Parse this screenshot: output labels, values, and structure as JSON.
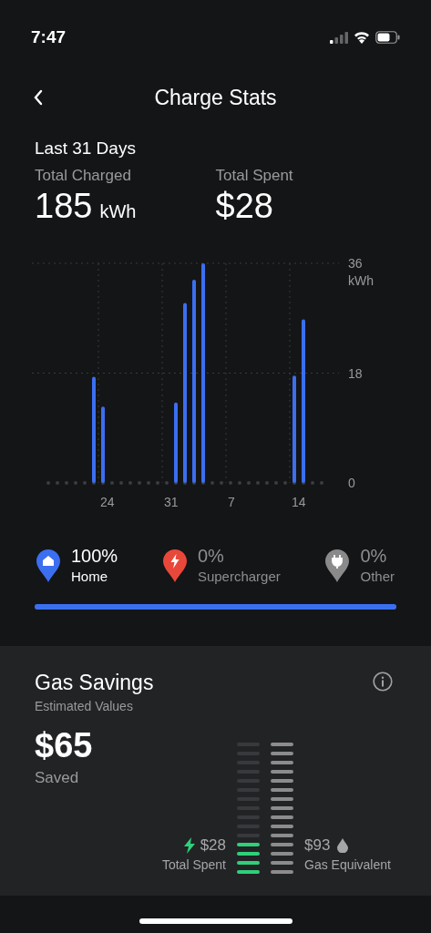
{
  "status_bar": {
    "time": "7:47"
  },
  "header": {
    "title": "Charge Stats"
  },
  "period": "Last 31 Days",
  "stats": [
    {
      "label": "Total Charged",
      "value": "185",
      "unit": "kWh"
    },
    {
      "label": "Total Spent",
      "value": "$28"
    }
  ],
  "chart_data": {
    "type": "bar",
    "ylabel": "kWh",
    "categories": [
      null,
      null,
      null,
      null,
      null,
      null,
      "24",
      null,
      null,
      null,
      null,
      null,
      null,
      "31",
      null,
      null,
      null,
      null,
      null,
      null,
      "7",
      null,
      null,
      null,
      null,
      null,
      null,
      "14",
      null,
      null,
      null
    ],
    "series": [
      {
        "color": "#3b6ff0",
        "values": [
          0,
          0,
          0,
          0,
          0,
          17.4,
          12.5,
          0,
          0,
          0,
          0,
          0,
          0,
          0,
          13.2,
          29.5,
          33.3,
          36,
          0,
          0,
          0,
          0,
          0,
          0,
          0,
          0,
          0,
          17.6,
          26.8,
          0,
          0
        ]
      }
    ],
    "yticks": [
      0,
      18,
      36
    ],
    "ylim": [
      0,
      36
    ]
  },
  "sources": [
    {
      "kind": "home",
      "percent": "100%",
      "label": "Home",
      "color": "#3b6ff0",
      "active": true
    },
    {
      "kind": "supercharger",
      "percent": "0%",
      "label": "Supercharger",
      "color": "#e8483a",
      "active": false
    },
    {
      "kind": "other",
      "percent": "0%",
      "label": "Other",
      "color": "#8a8a8a",
      "active": false
    }
  ],
  "share_bar": {
    "level": 1
  },
  "gas_savings": {
    "title": "Gas Savings",
    "subtitle": "Estimated Values",
    "amount": "$65",
    "amount_label": "Saved",
    "spent": {
      "value": "$28",
      "label": "Total Spent",
      "level": 0.27
    },
    "gas": {
      "value": "$93",
      "label": "Gas Equivalent",
      "level": 1
    }
  }
}
